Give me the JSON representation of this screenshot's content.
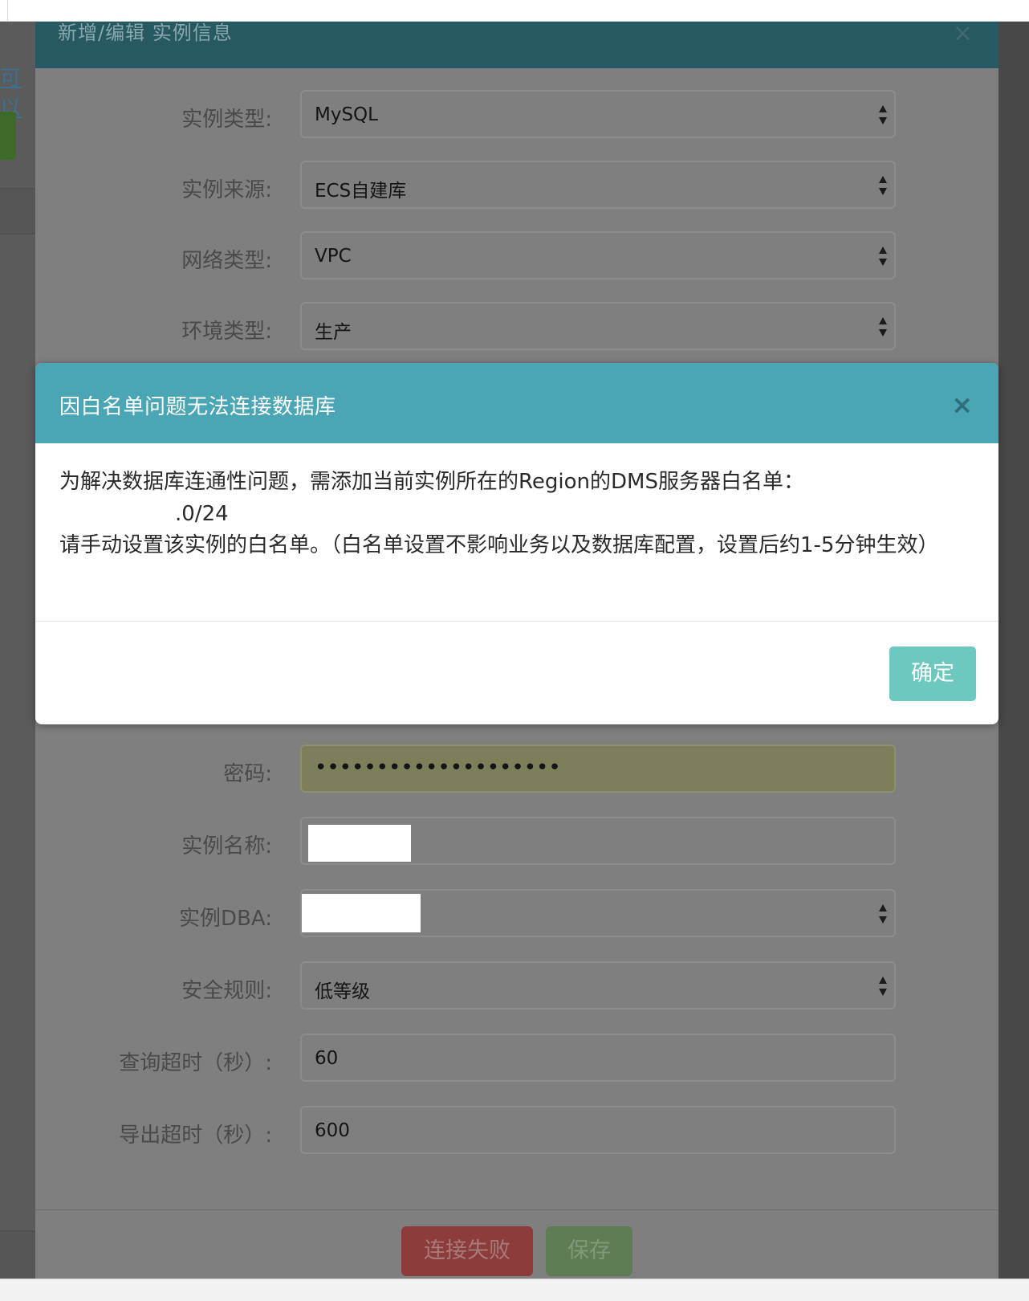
{
  "background": {
    "link_fragment": "可以"
  },
  "edit_modal": {
    "title": "新增/编辑 实例信息",
    "close_glyph": "×",
    "fields": [
      {
        "label": "实例类型:",
        "value": "MySQL",
        "type": "select"
      },
      {
        "label": "实例来源:",
        "value": "ECS自建库",
        "type": "select"
      },
      {
        "label": "网络类型:",
        "value": "VPC",
        "type": "select"
      },
      {
        "label": "环境类型:",
        "value": "生产",
        "type": "select"
      },
      {
        "label": "密码:",
        "value": "••••••••••••••••••••",
        "type": "password"
      },
      {
        "label": "实例名称:",
        "value": "",
        "type": "text"
      },
      {
        "label": "实例DBA:",
        "value": "",
        "type": "select"
      },
      {
        "label": "安全规则:",
        "value": "低等级",
        "type": "select"
      },
      {
        "label": "查询超时（秒）:",
        "value": "60",
        "type": "text"
      },
      {
        "label": "导出超时（秒）:",
        "value": "600",
        "type": "text"
      }
    ],
    "buttons": {
      "connect_failed": "连接失败",
      "save": "保存"
    }
  },
  "alert": {
    "title": "因白名单问题无法连接数据库",
    "close_glyph": "×",
    "message_line1": "为解决数据库连通性问题，需添加当前实例所在的Region的DMS服务器白名单：",
    "ip_fragment": ".0/24",
    "message_line3": "请手动设置该实例的白名单。（白名单设置不影响业务以及数据库配置，设置后约1-5分钟生效）",
    "ok_label": "确定"
  },
  "colors": {
    "alert_header": "#4aa6b4",
    "ok_button": "#6dc9bf",
    "edit_header": "#265962",
    "danger_button": "#8c3d3b",
    "save_button": "#5f7d55"
  }
}
